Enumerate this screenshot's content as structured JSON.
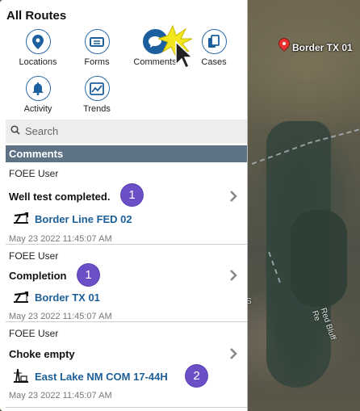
{
  "panel": {
    "title": "All Routes",
    "nav": [
      {
        "label": "Locations",
        "icon": "location-pin-icon"
      },
      {
        "label": "Forms",
        "icon": "form-ticket-icon"
      },
      {
        "label": "Comments",
        "icon": "comment-bubble-icon",
        "active": true
      },
      {
        "label": "Cases",
        "icon": "copy-document-icon"
      },
      {
        "label": "Activity",
        "icon": "bell-icon"
      },
      {
        "label": "Trends",
        "icon": "trend-chart-icon"
      }
    ],
    "search": {
      "placeholder": "Search"
    },
    "section_header": "Comments",
    "comments": [
      {
        "user": "FOEE User",
        "title": "Well test completed.",
        "location": "Border Line FED 02",
        "timestamp": "May 23 2022 11:45:07 AM",
        "badge": "1"
      },
      {
        "user": "FOEE User",
        "title": "Completion",
        "location": "Border TX 01",
        "timestamp": "May 23 2022 11:45:07 AM",
        "badge": "1"
      },
      {
        "user": "FOEE User",
        "title": "Choke empty",
        "location": "East Lake NM COM 17-44H",
        "timestamp": "May 23 2022 11:45:07 AM",
        "badge": "2"
      }
    ]
  },
  "map": {
    "marker_label": "Border TX 01",
    "river_label": "Red Bluff Re",
    "small_label": "S"
  },
  "colors": {
    "accent": "#1c5f9e",
    "section_header_bg": "#5e7385",
    "badge": "#6b4fc7",
    "marker": "#e6312f"
  }
}
